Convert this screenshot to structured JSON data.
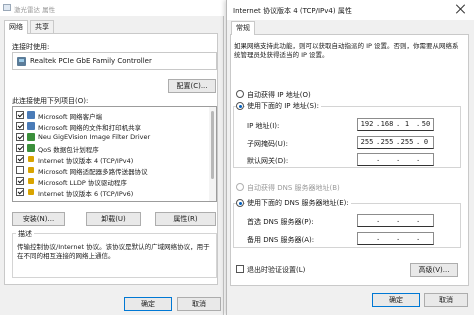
{
  "left_dialog": {
    "title": "激光雷达 属性",
    "tabs": [
      {
        "label": "网络",
        "active": true
      },
      {
        "label": "共享",
        "active": false
      }
    ],
    "connect_using_label": "连接时使用:",
    "adapter_name": "Realtek PCIe GbE Family Controller",
    "configure_button": "配置(C)...",
    "items_label": "此连接使用下列项目(O):",
    "items": [
      {
        "label": "Microsoft 网络客户端",
        "checked": true,
        "icon": "network-client-icon"
      },
      {
        "label": "Microsoft 网络的文件和打印机共享",
        "checked": true,
        "icon": "file-share-icon"
      },
      {
        "label": "Neu GigEVision Image Filter Driver",
        "checked": true,
        "icon": "driver-icon"
      },
      {
        "label": "QoS 数据包计划程序",
        "checked": true,
        "icon": "qos-icon"
      },
      {
        "label": "Internet 协议版本 4 (TCP/IPv4)",
        "checked": true,
        "icon": "protocol-icon"
      },
      {
        "label": "Microsoft 网络适配器多路传送器协议",
        "checked": false,
        "icon": "protocol-icon"
      },
      {
        "label": "Microsoft LLDP 协议驱动程序",
        "checked": true,
        "icon": "protocol-icon"
      },
      {
        "label": "Internet 协议版本 6 (TCP/IPv6)",
        "checked": true,
        "icon": "protocol-icon"
      }
    ],
    "install_button": "安装(N)...",
    "uninstall_button": "卸载(U)",
    "properties_button": "属性(R)",
    "description_title": "描述",
    "description_text": "传输控制协议/Internet 协议。该协议是默认的广域网络协议，用于在不同的相互连接的网络上通信。",
    "ok_button": "确定",
    "cancel_button": "取消"
  },
  "right_dialog": {
    "title": "Internet 协议版本 4 (TCP/IPv4) 属性",
    "tab": "常规",
    "intro_text": "如果网络支持此功能，则可以获取自动指派的 IP 设置。否则，你需要从网络系统管理员处获得适当的 IP 设置。",
    "auto_ip_label": "自动获得 IP 地址(O)",
    "use_ip_label": "使用下面的 IP 地址(S):",
    "ip_address_label": "IP 地址(I):",
    "ip_address": [
      "192",
      "168",
      "1",
      "50"
    ],
    "subnet_label": "子网掩码(U):",
    "subnet_mask": [
      "255",
      "255",
      "255",
      "0"
    ],
    "gateway_label": "默认网关(D):",
    "gateway": [
      "",
      "",
      "",
      ""
    ],
    "auto_dns_label": "自动获得 DNS 服务器地址(B)",
    "use_dns_label": "使用下面的 DNS 服务器地址(E):",
    "preferred_dns_label": "首选 DNS 服务器(P):",
    "preferred_dns": [
      "",
      "",
      "",
      ""
    ],
    "alternate_dns_label": "备用 DNS 服务器(A):",
    "alternate_dns": [
      "",
      "",
      "",
      ""
    ],
    "validate_label": "退出时验证设置(L)",
    "advanced_button": "高级(V)...",
    "ok_button": "确定",
    "cancel_button": "取消"
  },
  "colors": {
    "accent": "#0078d4",
    "dialog_bg": "#f0f0f0",
    "panel_bg": "#ffffff"
  }
}
